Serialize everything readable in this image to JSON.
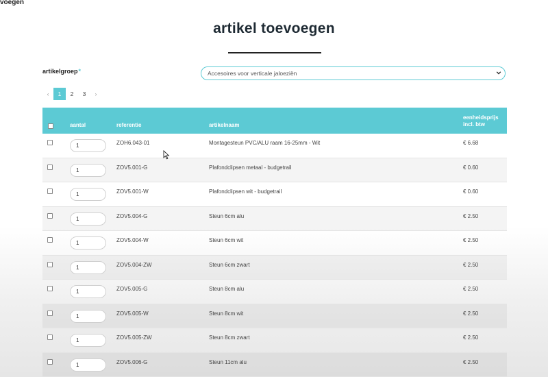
{
  "header": {
    "fragment": "voegen"
  },
  "page": {
    "title": "artikel toevoegen"
  },
  "form": {
    "artikelgroep_label": "artikelgroep",
    "required_mark": "*",
    "selected_group": "Accesoires voor verticale jaloeziën"
  },
  "pagination": {
    "prev": "‹",
    "pages": [
      "1",
      "2",
      "3"
    ],
    "active": "1",
    "next": "›"
  },
  "table": {
    "headers": {
      "aantal": "aantal",
      "referentie": "referentie",
      "artikelnaam": "artikelnaam",
      "prijs_line1": "eenheidsprijs",
      "prijs_line2": "incl. btw"
    },
    "rows": [
      {
        "qty": "1",
        "ref": "ZOH6.043-01",
        "name": "Montagesteun PVC/ALU raam 16-25mm - Wit",
        "price": "€ 6.68"
      },
      {
        "qty": "1",
        "ref": "ZOV5.001-G",
        "name": "Plafondclipsen metaal - budgetrail",
        "price": "€ 0.60"
      },
      {
        "qty": "1",
        "ref": "ZOV5.001-W",
        "name": "Plafondclipsen wit - budgetrail",
        "price": "€ 0.60"
      },
      {
        "qty": "1",
        "ref": "ZOV5.004-G",
        "name": "Steun 6cm alu",
        "price": "€ 2.50"
      },
      {
        "qty": "1",
        "ref": "ZOV5.004-W",
        "name": "Steun 6cm wit",
        "price": "€ 2.50"
      },
      {
        "qty": "1",
        "ref": "ZOV5.004-ZW",
        "name": "Steun 6cm zwart",
        "price": "€ 2.50"
      },
      {
        "qty": "1",
        "ref": "ZOV5.005-G",
        "name": "Steun 8cm alu",
        "price": "€ 2.50"
      },
      {
        "qty": "1",
        "ref": "ZOV5.005-W",
        "name": "Steun 8cm wit",
        "price": "€ 2.50"
      },
      {
        "qty": "1",
        "ref": "ZOV5.005-ZW",
        "name": "Steun 8cm zwart",
        "price": "€ 2.50"
      },
      {
        "qty": "1",
        "ref": "ZOV5.006-G",
        "name": "Steun 11cm alu",
        "price": "€ 2.50"
      }
    ]
  },
  "colors": {
    "accent": "#5ccad4",
    "title": "#1e2a33"
  },
  "icons": {
    "select_chevron": "chevron-down-icon",
    "cursor": "mouse-pointer-icon"
  }
}
